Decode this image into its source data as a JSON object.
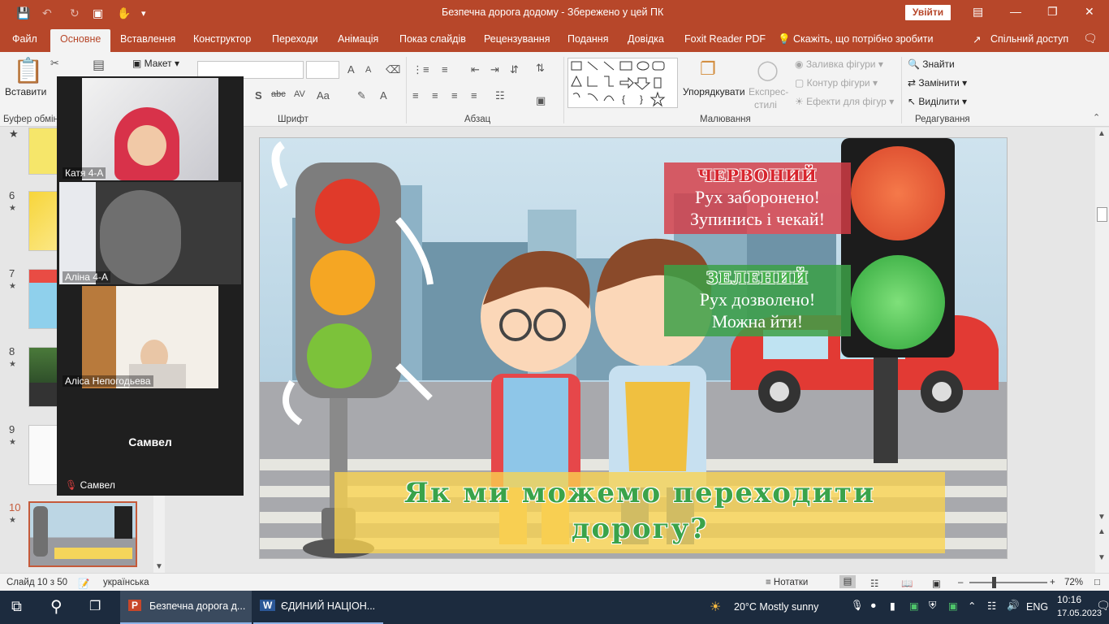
{
  "titlebar": {
    "title": "Безпечна дорога додому  -  Збережено у цей ПК",
    "signin": "Увійти"
  },
  "tabs": [
    "Файл",
    "Основне",
    "Вставлення",
    "Конструктор",
    "Переходи",
    "Анімація",
    "Показ слайдів",
    "Рецензування",
    "Подання",
    "Довідка",
    "Foxit Reader PDF"
  ],
  "tell_me": "Скажіть, що потрібно зробити",
  "share": "Спільний доступ",
  "ribbon": {
    "paste": "Вставити",
    "layout": "Макет",
    "clipboard_group": "Буфер обмін",
    "font_group": "Шрифт",
    "paragraph_group": "Абзац",
    "drawing_group": "Малювання",
    "editing_group": "Редагування",
    "arrange": "Упорядкувати",
    "quick_styles_1": "Експрес-",
    "quick_styles_2": "стилі",
    "shape_fill": "Заливка фігури",
    "shape_outline": "Контур фігури",
    "shape_effects": "Ефекти для фігур",
    "find": "Знайти",
    "replace": "Замінити",
    "select": "Виділити"
  },
  "thumbnails": [
    {
      "num": "6",
      "star": "★"
    },
    {
      "num": "7",
      "star": "★"
    },
    {
      "num": "8",
      "star": "★"
    },
    {
      "num": "9",
      "star": "★"
    },
    {
      "num": "10",
      "star": "★"
    }
  ],
  "zoom": {
    "participants": [
      "Катя  4-А",
      "Аліна 4-А",
      "Аліса Непогодьева"
    ],
    "audio_only": "Самвел",
    "audio_only_label": "Самвел"
  },
  "slide": {
    "red_title": "ЧЕРВОНИЙ",
    "red_line1": "Рух заборонено!",
    "red_line2": "Зупинись і чекай!",
    "green_title": "ЗЕЛЕНИЙ",
    "green_line1": "Рух дозволено!",
    "green_line2": "Можна йти!",
    "banner_line1": "Як ми можемо переходити",
    "banner_line2": "дорогу?"
  },
  "status": {
    "slide_counter": "Слайд 10 з 50",
    "language": "українська",
    "notes": "Нотатки",
    "zoom": "72%"
  },
  "taskbar": {
    "ppt_task": "Безпечна дорога д...",
    "word_task": "ЄДИНИЙ НАЦІОН...",
    "weather": "20°C  Mostly sunny",
    "lang": "ENG",
    "time": "10:16",
    "date": "17.05.2023"
  },
  "colors": {
    "accent": "#b7472a",
    "red_panel": "#d63c46",
    "green_panel": "#3ca046",
    "banner": "#fad450"
  }
}
